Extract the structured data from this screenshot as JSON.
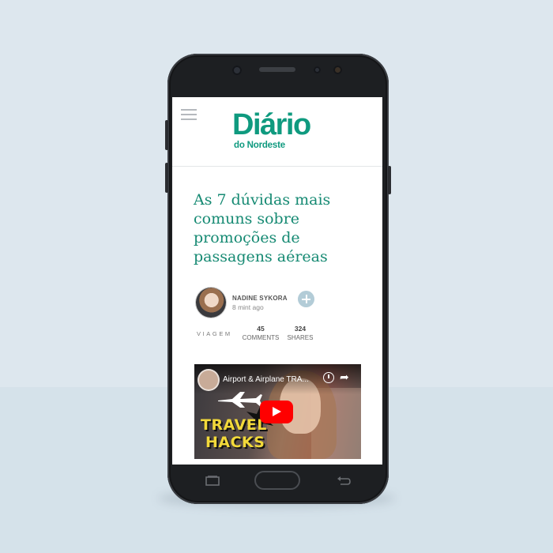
{
  "site": {
    "logo_main": "Diário",
    "logo_sub": "do Nordeste",
    "brand_color": "#0f9a7f"
  },
  "article": {
    "headline": "As 7 dúvidas mais comuns sobre promoções de passagens aéreas",
    "author": {
      "name": "NADINE SYKORA",
      "time": "8 mint ago"
    },
    "category": "VIAGEM",
    "stats": {
      "comments_count": "45",
      "comments_label": "COMMENTS",
      "shares_count": "324",
      "shares_label": "SHARES"
    }
  },
  "video": {
    "title": "Airport & Airplane TRA...",
    "overlay_line1": "TRAVEL",
    "overlay_line2": "HACKS"
  },
  "icons": {
    "menu": "hamburger-menu-icon",
    "follow": "plus-circle-icon",
    "watch_later": "clock-icon",
    "share": "share-arrow-icon",
    "play": "youtube-play-icon",
    "recents": "recent-apps-icon",
    "back": "back-icon"
  }
}
